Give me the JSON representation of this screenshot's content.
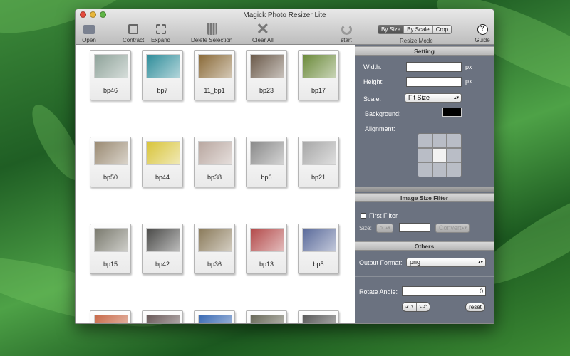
{
  "window": {
    "title": "Magick Photo Resizer Lite"
  },
  "toolbar": {
    "open_label": "Open",
    "contract_label": "Contract",
    "expand_label": "Expand",
    "delete_label": "Delete Selection",
    "clear_label": "Clear All",
    "start_label": "start",
    "guide_label": "Guide",
    "resize_mode_label": "Resize Mode",
    "modes": [
      "By Size",
      "By Scale",
      "Crop"
    ],
    "active_mode": "By Size"
  },
  "gallery": {
    "items": [
      {
        "label": "bp46",
        "color": "#8fa39a"
      },
      {
        "label": "bp7",
        "color": "#2f8d9a"
      },
      {
        "label": "11_bp1",
        "color": "#8a6a38"
      },
      {
        "label": "bp23",
        "color": "#6b5a4a"
      },
      {
        "label": "bp17",
        "color": "#6b8a3a"
      },
      {
        "label": "bp50",
        "color": "#9a8a72"
      },
      {
        "label": "bp44",
        "color": "#d8c43a"
      },
      {
        "label": "bp38",
        "color": "#b9a7a0"
      },
      {
        "label": "bp6",
        "color": "#8a8a8a"
      },
      {
        "label": "bp21",
        "color": "#a7a7a7"
      },
      {
        "label": "bp15",
        "color": "#7a7a6e"
      },
      {
        "label": "bp42",
        "color": "#4a4a48"
      },
      {
        "label": "bp36",
        "color": "#8a7a5a"
      },
      {
        "label": "bp13",
        "color": "#b34a4a"
      },
      {
        "label": "bp5",
        "color": "#5a6a9a"
      },
      {
        "label": "",
        "color": "#c86a4a"
      },
      {
        "label": "",
        "color": "#6a5a5a"
      },
      {
        "label": "",
        "color": "#3a6ab4"
      },
      {
        "label": "",
        "color": "#6a6a5a"
      },
      {
        "label": "",
        "color": "#5a5a5a"
      }
    ]
  },
  "setting": {
    "header": "Setting",
    "width_label": "Width:",
    "height_label": "Height:",
    "width_value": "",
    "height_value": "",
    "unit": "px",
    "scale_label": "Scale:",
    "scale_value": "Fit Size",
    "background_label": "Background:",
    "background_color": "#000000",
    "alignment_label": "Alignment:",
    "alignment_selected": "center"
  },
  "filter": {
    "header": "Image Size Filter",
    "first_filter_label": "First Filter",
    "size_label": "Size:",
    "compare_value": "> ",
    "size_value": "",
    "convert_label": "Convert"
  },
  "others": {
    "header": "Others",
    "output_label": "Output Format:",
    "output_value": "png",
    "rotate_label": "Rotate Angle:",
    "rotate_value": "0",
    "reset_label": "reset"
  }
}
